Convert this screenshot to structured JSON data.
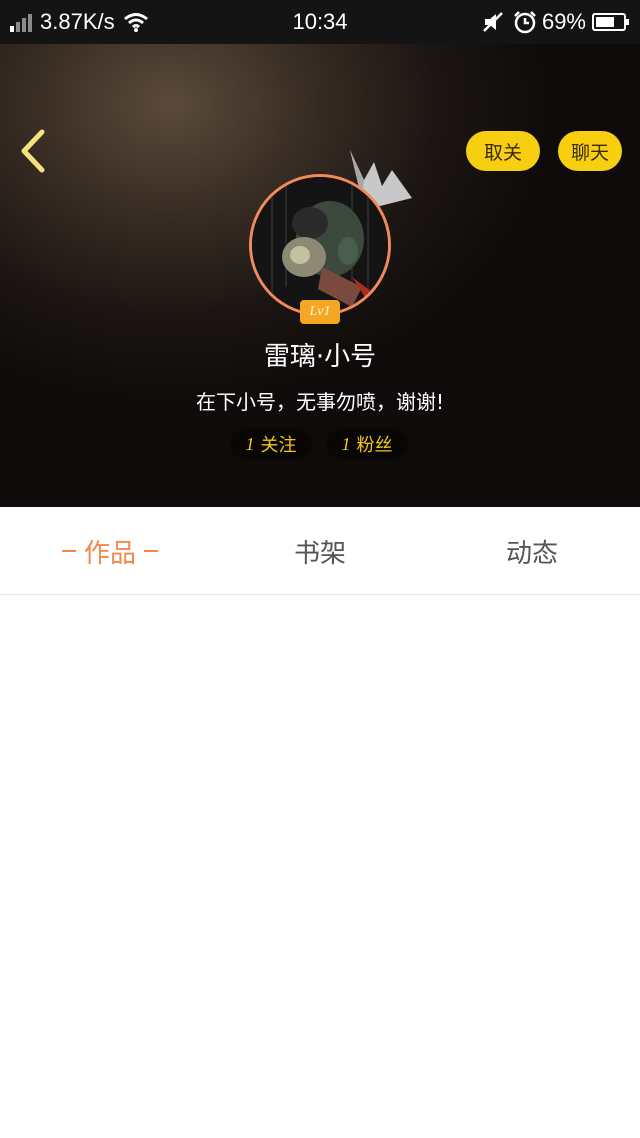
{
  "status_bar": {
    "network_speed": "3.87K/s",
    "time": "10:34",
    "battery_percent": "69%",
    "icons": [
      "signal-icon",
      "wifi-icon",
      "mute-icon",
      "alarm-icon",
      "battery-icon"
    ]
  },
  "header": {
    "back_icon": "chevron-left-icon",
    "unfollow_label": "取关",
    "chat_label": "聊天",
    "level": "Lv1",
    "username": "雷璃·小号",
    "bio": "在下小号，无事勿喷，谢谢!",
    "following_count": "1",
    "following_label": "关注",
    "fans_count": "1",
    "fans_label": "粉丝"
  },
  "tabs": [
    {
      "label": "作品",
      "active": true
    },
    {
      "label": "书架",
      "active": false
    },
    {
      "label": "动态",
      "active": false
    }
  ],
  "colors": {
    "accent_orange": "#f08a4b",
    "pill_yellow": "#f8cf10",
    "stat_yellow": "#f3c61c",
    "avatar_ring": "#f08a5d"
  }
}
